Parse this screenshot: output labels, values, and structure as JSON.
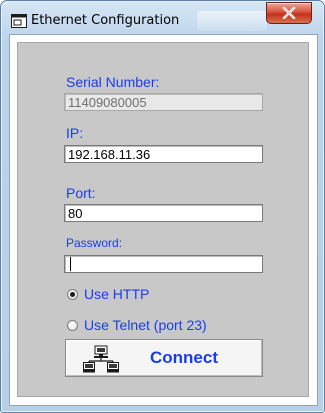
{
  "window": {
    "title": "Ethernet Configuration",
    "icon": "window-app-icon",
    "close_icon": "close-icon"
  },
  "form": {
    "serial_number": {
      "label": "Serial Number:",
      "value": "11409080005"
    },
    "ip": {
      "label": "IP:",
      "value": "192.168.11.36"
    },
    "port": {
      "label": "Port:",
      "value": "80"
    },
    "password": {
      "label": "Password:",
      "value": ""
    },
    "protocol": {
      "options": [
        {
          "label": "Use HTTP",
          "selected": true
        },
        {
          "label": "Use Telnet (port 23)",
          "selected": false
        }
      ]
    },
    "connect": {
      "label": "Connect",
      "icon": "network-computers-icon"
    }
  },
  "colors": {
    "label_blue": "#1a3cf0",
    "panel_gray": "#c8c8c8",
    "close_red": "#c1321c"
  }
}
